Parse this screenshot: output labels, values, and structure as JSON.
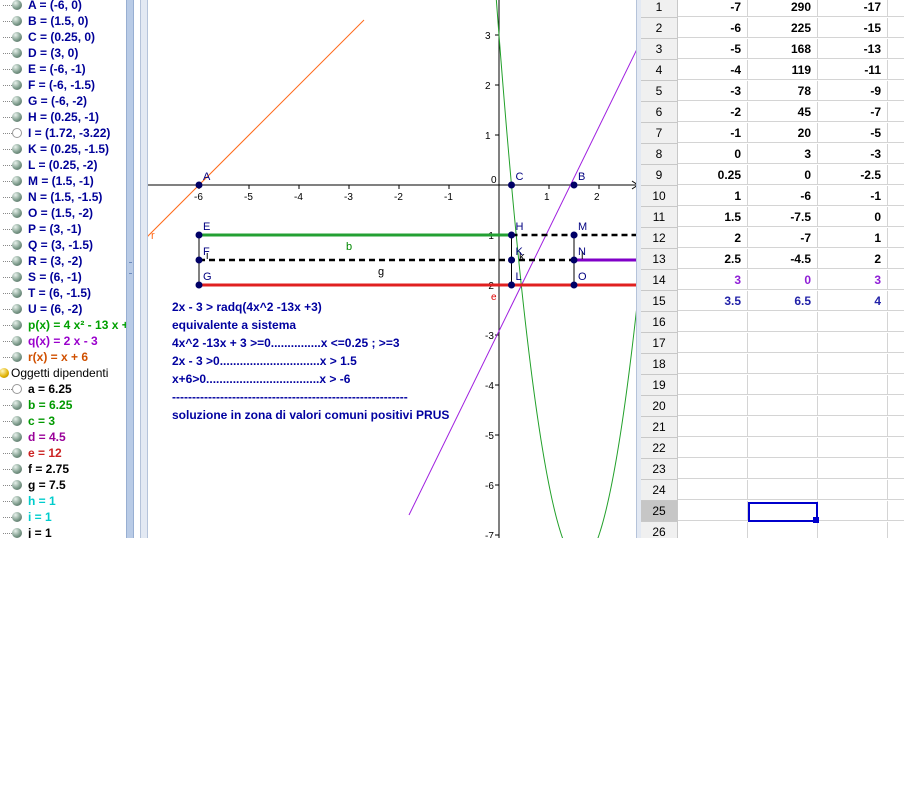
{
  "algebra": {
    "free": [
      {
        "text": "A = (-6, 0)",
        "color": "#000099",
        "icon": "point-icon"
      },
      {
        "text": "B = (1.5, 0)",
        "color": "#000099",
        "icon": "point-icon"
      },
      {
        "text": "C = (0.25, 0)",
        "color": "#000099",
        "icon": "point-icon"
      },
      {
        "text": "D = (3, 0)",
        "color": "#000099",
        "icon": "point-icon"
      },
      {
        "text": "E = (-6, -1)",
        "color": "#000099",
        "icon": "point-icon"
      },
      {
        "text": "F = (-6, -1.5)",
        "color": "#000099",
        "icon": "point-icon"
      },
      {
        "text": "G = (-6, -2)",
        "color": "#000099",
        "icon": "point-icon"
      },
      {
        "text": "H = (0.25, -1)",
        "color": "#000099",
        "icon": "point-icon"
      },
      {
        "text": "I = (1.72, -3.22)",
        "color": "#000099",
        "icon": "hidden-point-icon"
      },
      {
        "text": "K = (0.25, -1.5)",
        "color": "#000099",
        "icon": "point-icon"
      },
      {
        "text": "L = (0.25, -2)",
        "color": "#000099",
        "icon": "point-icon"
      },
      {
        "text": "M = (1.5, -1)",
        "color": "#000099",
        "icon": "point-icon"
      },
      {
        "text": "N = (1.5, -1.5)",
        "color": "#000099",
        "icon": "point-icon"
      },
      {
        "text": "O = (1.5, -2)",
        "color": "#000099",
        "icon": "point-icon"
      },
      {
        "text": "P = (3, -1)",
        "color": "#000099",
        "icon": "point-icon"
      },
      {
        "text": "Q = (3, -1.5)",
        "color": "#000099",
        "icon": "point-icon"
      },
      {
        "text": "R = (3, -2)",
        "color": "#000099",
        "icon": "point-icon"
      },
      {
        "text": "S = (6, -1)",
        "color": "#000099",
        "icon": "point-icon"
      },
      {
        "text": "T = (6, -1.5)",
        "color": "#000099",
        "icon": "point-icon"
      },
      {
        "text": "U = (6, -2)",
        "color": "#000099",
        "icon": "point-icon"
      },
      {
        "text": "p(x) = 4 x² - 13 x +",
        "color": "#00a000",
        "icon": "function-icon"
      },
      {
        "text": "q(x) = 2 x - 3",
        "color": "#9900cc",
        "icon": "function-icon"
      },
      {
        "text": "r(x) = x + 6",
        "color": "#d05000",
        "icon": "function-icon"
      }
    ],
    "dependent_header": "Oggetti dipendenti",
    "dependent": [
      {
        "text": "a = 6.25",
        "color": "#000000",
        "icon": "hidden-segment-icon"
      },
      {
        "text": "b = 6.25",
        "color": "#009900",
        "icon": "segment-icon"
      },
      {
        "text": "c = 3",
        "color": "#009900",
        "icon": "segment-icon"
      },
      {
        "text": "d = 4.5",
        "color": "#990099",
        "icon": "segment-icon"
      },
      {
        "text": "e = 12",
        "color": "#cc2222",
        "icon": "segment-icon"
      },
      {
        "text": "f = 2.75",
        "color": "#000000",
        "icon": "segment-icon"
      },
      {
        "text": "g = 7.5",
        "color": "#000000",
        "icon": "segment-icon"
      },
      {
        "text": "h = 1",
        "color": "#00cccc",
        "icon": "segment-icon"
      },
      {
        "text": "i = 1",
        "color": "#00cccc",
        "icon": "segment-icon"
      },
      {
        "text": "j = 1",
        "color": "#000000",
        "icon": "segment-icon"
      }
    ]
  },
  "graphics": {
    "x_ticks": [
      "-6",
      "-5",
      "-4",
      "-3",
      "-2",
      "-1",
      "0",
      "1",
      "2"
    ],
    "y_ticks": [
      "3",
      "2",
      "1",
      "-1",
      "-2",
      "-3",
      "-4",
      "-5",
      "-6",
      "-7"
    ],
    "point_labels": [
      "A",
      "B",
      "C",
      "E",
      "F",
      "G",
      "H",
      "K",
      "L",
      "M",
      "N",
      "O"
    ],
    "segment_labels": {
      "b": "b",
      "g": "g",
      "k": "k",
      "i": "i",
      "l": "l"
    },
    "curve_labels": {
      "r": "r",
      "e": "e"
    },
    "colors": {
      "p": "#22a02a",
      "q": "#a020e0",
      "r": "#ff6a1a",
      "seg_green": "#23a033",
      "seg_red": "#e02020",
      "seg_purple": "#8000c8",
      "point": "#000066"
    },
    "notes": [
      "2x - 3 > radq(4x^2 -13x +3)",
      "equivalente a sistema",
      "4x^2 -13x + 3 >=0...............x  <=0.25 ; >=3",
      "2x - 3 >0..............................x  > 1.5",
      "x+6>0..................................x > -6",
      "-----------------------------------------------------------",
      "soluzione in zona di valori comuni positivi PRUS"
    ]
  },
  "spreadsheet": {
    "rows": [
      {
        "n": "1",
        "a": "-7",
        "b": "290",
        "c": "-17",
        "color": "black"
      },
      {
        "n": "2",
        "a": "-6",
        "b": "225",
        "c": "-15",
        "color": "black"
      },
      {
        "n": "3",
        "a": "-5",
        "b": "168",
        "c": "-13",
        "color": "black"
      },
      {
        "n": "4",
        "a": "-4",
        "b": "119",
        "c": "-11",
        "color": "black"
      },
      {
        "n": "5",
        "a": "-3",
        "b": "78",
        "c": "-9",
        "color": "black"
      },
      {
        "n": "6",
        "a": "-2",
        "b": "45",
        "c": "-7",
        "color": "black"
      },
      {
        "n": "7",
        "a": "-1",
        "b": "20",
        "c": "-5",
        "color": "black"
      },
      {
        "n": "8",
        "a": "0",
        "b": "3",
        "c": "-3",
        "color": "black"
      },
      {
        "n": "9",
        "a": "0.25",
        "b": "0",
        "c": "-2.5",
        "color": "black"
      },
      {
        "n": "10",
        "a": "1",
        "b": "-6",
        "c": "-1",
        "color": "black"
      },
      {
        "n": "11",
        "a": "1.5",
        "b": "-7.5",
        "c": "0",
        "color": "black"
      },
      {
        "n": "12",
        "a": "2",
        "b": "-7",
        "c": "1",
        "color": "black"
      },
      {
        "n": "13",
        "a": "2.5",
        "b": "-4.5",
        "c": "2",
        "color": "black"
      },
      {
        "n": "14",
        "a": "3",
        "b": "0",
        "c": "3",
        "color": "purple"
      },
      {
        "n": "15",
        "a": "3.5",
        "b": "6.5",
        "c": "4",
        "color": "blue"
      },
      {
        "n": "16",
        "a": "",
        "b": "",
        "c": "",
        "color": "black"
      },
      {
        "n": "17",
        "a": "",
        "b": "",
        "c": "",
        "color": "black"
      },
      {
        "n": "18",
        "a": "",
        "b": "",
        "c": "",
        "color": "black"
      },
      {
        "n": "19",
        "a": "",
        "b": "",
        "c": "",
        "color": "black"
      },
      {
        "n": "20",
        "a": "",
        "b": "",
        "c": "",
        "color": "black"
      },
      {
        "n": "21",
        "a": "",
        "b": "",
        "c": "",
        "color": "black"
      },
      {
        "n": "22",
        "a": "",
        "b": "",
        "c": "",
        "color": "black"
      },
      {
        "n": "23",
        "a": "",
        "b": "",
        "c": "",
        "color": "black"
      },
      {
        "n": "24",
        "a": "",
        "b": "",
        "c": "",
        "color": "black"
      },
      {
        "n": "25",
        "a": "",
        "b": "",
        "c": "",
        "color": "black"
      },
      {
        "n": "26",
        "a": "",
        "b": "",
        "c": "",
        "color": "black"
      }
    ],
    "selected_row": "25"
  }
}
